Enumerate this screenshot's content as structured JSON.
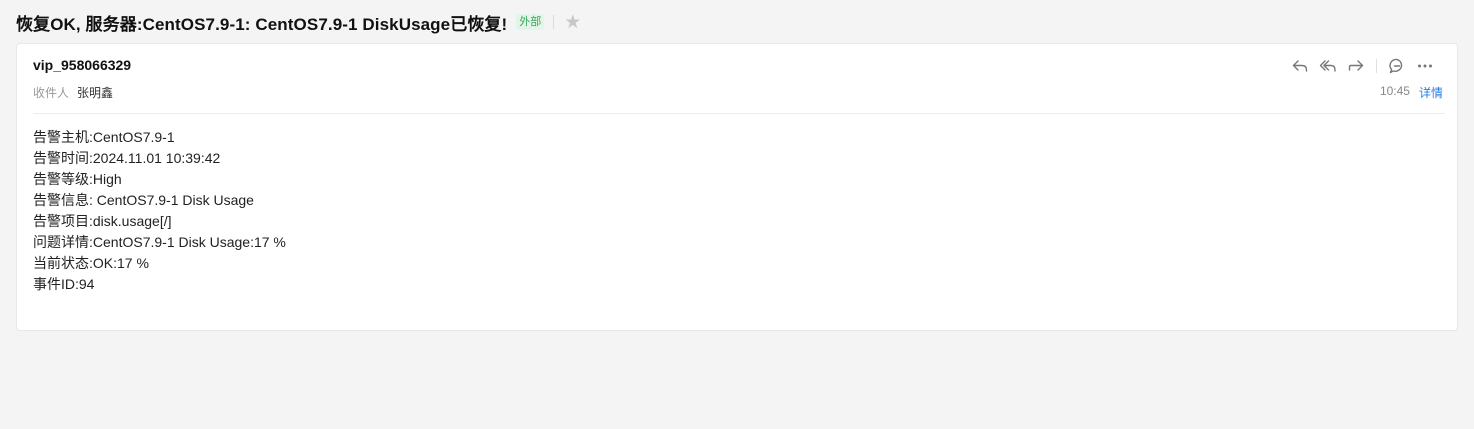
{
  "subject": "恢复OK, 服务器:CentOS7.9-1: CentOS7.9-1 DiskUsage已恢复!",
  "external_badge": "外部",
  "star_icon": "star-icon",
  "sender": "vip_958066329",
  "recipient_label": "收件人",
  "recipient_name": "张明鑫",
  "time": "10:45",
  "details_label": "详情",
  "actions": [
    "reply-icon",
    "reply-all-icon",
    "forward-icon",
    "comment-icon",
    "more-icon"
  ],
  "body": [
    "告警主机:CentOS7.9-1",
    "告警时间:2024.11.01 10:39:42",
    "告警等级:High",
    "告警信息: CentOS7.9-1 Disk Usage",
    "告警项目:disk.usage[/]",
    "问题详情:CentOS7.9-1 Disk Usage:17 %",
    "当前状态:OK:17 %",
    "事件ID:94"
  ]
}
